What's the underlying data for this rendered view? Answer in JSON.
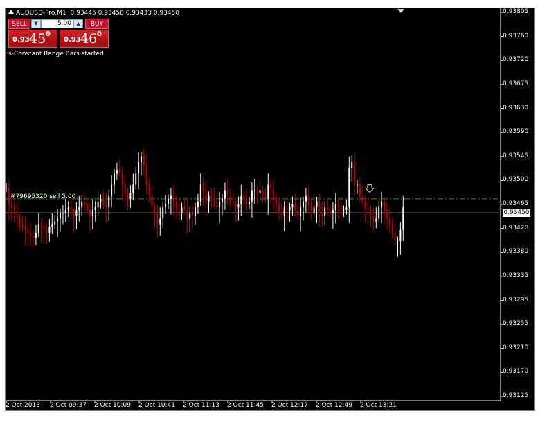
{
  "header": {
    "symbol": "AUDUSD-Pro,M1",
    "ohlc": "0.93445 0.93458 0.93433 0.93450"
  },
  "trade_panel": {
    "sell_label": "SELL",
    "buy_label": "BUY",
    "lot_value": "5.00",
    "sell_price_small": "0.93",
    "sell_price_big": "45",
    "sell_price_sup": "0",
    "buy_price_small": "0.93",
    "buy_price_big": "46",
    "buy_price_sup": "0"
  },
  "status": {
    "started": "s-Constant Range Bars started",
    "order": "#79695320 sell 5.00"
  },
  "price_axis": {
    "ticks": [
      "0.93805",
      "0.93760",
      "0.93720",
      "0.93675",
      "0.93630",
      "0.93590",
      "0.93545",
      "0.93500",
      "0.93465",
      "0.93420",
      "0.93380",
      "0.93335",
      "0.93295",
      "0.93255",
      "0.93210",
      "0.93170",
      "0.93125"
    ],
    "current_price": "0.93450"
  },
  "time_axis": {
    "ticks": [
      "2 Oct 2013",
      "2 Oct 09:37",
      "2 Oct 10:09",
      "2 Oct 10:41",
      "2 Oct 11:13",
      "2 Oct 11:45",
      "2 Oct 12:17",
      "2 Oct 12:49",
      "2 Oct 13:21"
    ]
  },
  "colors": {
    "background": "#000000",
    "bull": "#ffffff",
    "bear": "#c00000",
    "order_line": "#2e8b2e",
    "bid_line": "#c0c0c0"
  },
  "chart_data": {
    "type": "candlestick",
    "ylim": [
      0.93125,
      0.93805
    ],
    "order_price": 0.93475,
    "bid_price": 0.9345,
    "x": [
      "2 Oct 2013",
      "2 Oct 09:37",
      "2 Oct 10:09",
      "2 Oct 10:41",
      "2 Oct 11:13",
      "2 Oct 11:45",
      "2 Oct 12:17",
      "2 Oct 12:49",
      "2 Oct 13:21"
    ],
    "close_values": [
      0.93495,
      0.93465,
      0.9346,
      0.93455,
      0.9344,
      0.9343,
      0.93425,
      0.9342,
      0.93415,
      0.9341,
      0.93405,
      0.93415,
      0.9343,
      0.93425,
      0.9342,
      0.93415,
      0.93425,
      0.9343,
      0.93435,
      0.9344,
      0.9345,
      0.9345,
      0.93455,
      0.9346,
      0.9345,
      0.93445,
      0.93455,
      0.9346,
      0.9347,
      0.93465,
      0.93455,
      0.93445,
      0.93455,
      0.9346,
      0.9347,
      0.93475,
      0.93465,
      0.9346,
      0.9348,
      0.935,
      0.9352,
      0.93525,
      0.9352,
      0.935,
      0.93485,
      0.93475,
      0.93485,
      0.935,
      0.9352,
      0.9354,
      0.9355,
      0.93535,
      0.935,
      0.9348,
      0.9346,
      0.9345,
      0.9343,
      0.9344,
      0.9346,
      0.93465,
      0.93475,
      0.9348,
      0.9347,
      0.9346,
      0.9345,
      0.9346,
      0.93455,
      0.9344,
      0.9345,
      0.93445,
      0.9346,
      0.9347,
      0.935,
      0.9349,
      0.9347,
      0.9348,
      0.93475,
      0.9347,
      0.9346,
      0.9347,
      0.93475,
      0.9349,
      0.9348,
      0.9347,
      0.93465,
      0.9346,
      0.93465,
      0.9348,
      0.93475,
      0.93465,
      0.9347,
      0.9349,
      0.9349,
      0.93485,
      0.9349,
      0.9348,
      0.93475,
      0.935,
      0.9349,
      0.93475,
      0.93465,
      0.9345,
      0.93445,
      0.9346,
      0.93455,
      0.9346,
      0.93465,
      0.93455,
      0.93445,
      0.9346,
      0.9347,
      0.9348,
      0.93465,
      0.9345,
      0.9346,
      0.9347,
      0.9345,
      0.93445,
      0.9346,
      0.93455,
      0.9345,
      0.93455,
      0.93465,
      0.9346,
      0.93455,
      0.93455,
      0.9346,
      0.9353,
      0.9354,
      0.935,
      0.935,
      0.9348,
      0.9347,
      0.9346,
      0.93455,
      0.93445,
      0.93435,
      0.9344,
      0.9346,
      0.9347,
      0.93455,
      0.9344,
      0.9343,
      0.93415,
      0.934,
      0.934,
      0.9342,
      0.9346
    ]
  }
}
